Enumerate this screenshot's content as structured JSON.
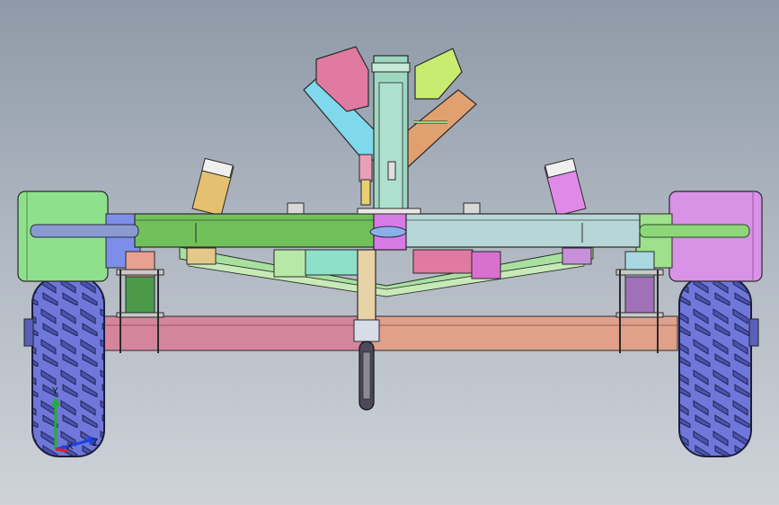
{
  "viewport": {
    "background": "#aeb6c0",
    "model": "boat-trailer-front-view"
  },
  "triad": {
    "x_label": "X",
    "y_label": "Y",
    "z_label": "Z",
    "x_color": "#e0202a",
    "y_color": "#20b030",
    "z_color": "#2040e0"
  },
  "parts": {
    "left_fender": "#8ee08c",
    "right_fender": "#d892e6",
    "main_beam_left": "#72c05a",
    "main_beam_right": "#b7d6d8",
    "rear_beam_left": "#d4859c",
    "rear_beam_right": "#e0a08a",
    "v_arm_left": "#7fd8ec",
    "v_arm_right": "#e0a070",
    "keel_pad_left": "#e07aa0",
    "keel_pad_right": "#c8ec70",
    "tyre": "#7a82e0",
    "center_post": "#e8d2a8",
    "hitch_block": "#d87ae6"
  }
}
